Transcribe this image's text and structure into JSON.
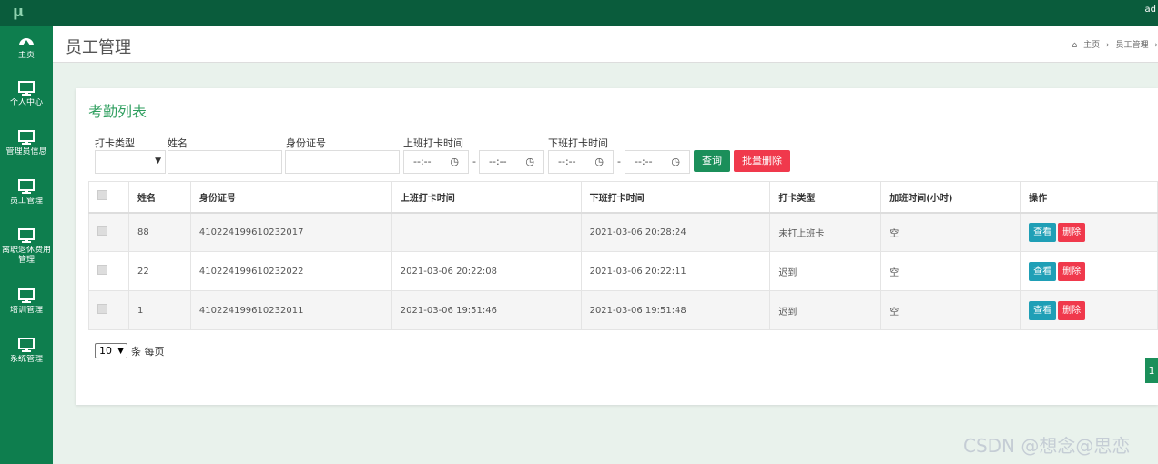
{
  "app": {
    "logo": "μ",
    "admin": "ad"
  },
  "sidebar": {
    "items": [
      {
        "label": "主页",
        "icon": "dashboard-icon"
      },
      {
        "label": "个人中心",
        "icon": "monitor-icon"
      },
      {
        "label": "管理员信息",
        "icon": "monitor-icon"
      },
      {
        "label": "员工管理",
        "icon": "monitor-icon"
      },
      {
        "label": "离职退休费用管理",
        "icon": "monitor-icon"
      },
      {
        "label": "培训管理",
        "icon": "monitor-icon"
      },
      {
        "label": "系统管理",
        "icon": "monitor-icon"
      }
    ]
  },
  "header": {
    "title": "员工管理",
    "breadcrumb": [
      "主页",
      "员工管理"
    ]
  },
  "card": {
    "title": "考勤列表",
    "filters": {
      "type_label": "打卡类型",
      "name_label": "姓名",
      "id_label": "身份证号",
      "on_time_label": "上班打卡时间",
      "off_time_label": "下班打卡时间",
      "time_placeholder": "--:--",
      "range_sep": "-"
    },
    "buttons": {
      "query": "查询",
      "batch_delete": "批量删除"
    },
    "table": {
      "headers": [
        "姓名",
        "身份证号",
        "上班打卡时间",
        "下班打卡时间",
        "打卡类型",
        "加班时间(小时)",
        "操作"
      ],
      "rows": [
        {
          "name": "88",
          "id": "410224199610232017",
          "on": "",
          "off": "2021-03-06 20:28:24",
          "type": "未打上班卡",
          "overtime": "空"
        },
        {
          "name": "22",
          "id": "410224199610232022",
          "on": "2021-03-06 20:22:08",
          "off": "2021-03-06 20:22:11",
          "type": "迟到",
          "overtime": "空"
        },
        {
          "name": "1",
          "id": "410224199610232011",
          "on": "2021-03-06 19:51:46",
          "off": "2021-03-06 19:51:48",
          "type": "迟到",
          "overtime": "空"
        }
      ],
      "view_label": "查看",
      "delete_label": "删除"
    },
    "page_size": "10",
    "per_page_label": "条 每页",
    "page": "1"
  },
  "watermark": "CSDN @想念@思恋"
}
